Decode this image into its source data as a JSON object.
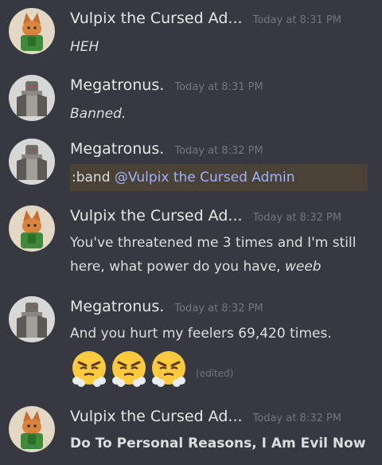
{
  "messages": [
    {
      "author": "Vulpix the Cursed Ad...",
      "timestamp": "Today at 8:31 PM",
      "text": "HEH",
      "avatar": "vulpix"
    },
    {
      "author": "Megatronus.",
      "timestamp": "Today at 8:31 PM",
      "text": "Banned.",
      "avatar": "megatron"
    },
    {
      "author": "Megatronus.",
      "timestamp": "Today at 8:32 PM",
      "text_prefix": ":band ",
      "mention": "@Vulpix the Cursed Admin",
      "avatar": "megatron"
    },
    {
      "author": "Vulpix the Cursed Ad...",
      "timestamp": "Today at 8:32 PM",
      "line1": "You've threatened me 3 times and I'm still",
      "line2": "here, what power do you have, ",
      "line2_italic": "weeb",
      "avatar": "vulpix"
    },
    {
      "author": "Megatronus.",
      "timestamp": "Today at 8:32 PM",
      "text": "And you hurt my feelers 69,420 times.",
      "emojis": [
        "triumph-face",
        "triumph-face",
        "triumph-face"
      ],
      "edited": "(edited)",
      "avatar": "megatron"
    },
    {
      "author": "Vulpix the Cursed Ad...",
      "timestamp": "Today at 8:32 PM",
      "text": "Do To Personal Reasons, I Am Evil Now",
      "avatar": "vulpix"
    }
  ],
  "colors": {
    "background": "#36393f",
    "timestamp": "#72767d",
    "mention_text": "#9fb1ff",
    "mention_bg": "#4a4236"
  }
}
